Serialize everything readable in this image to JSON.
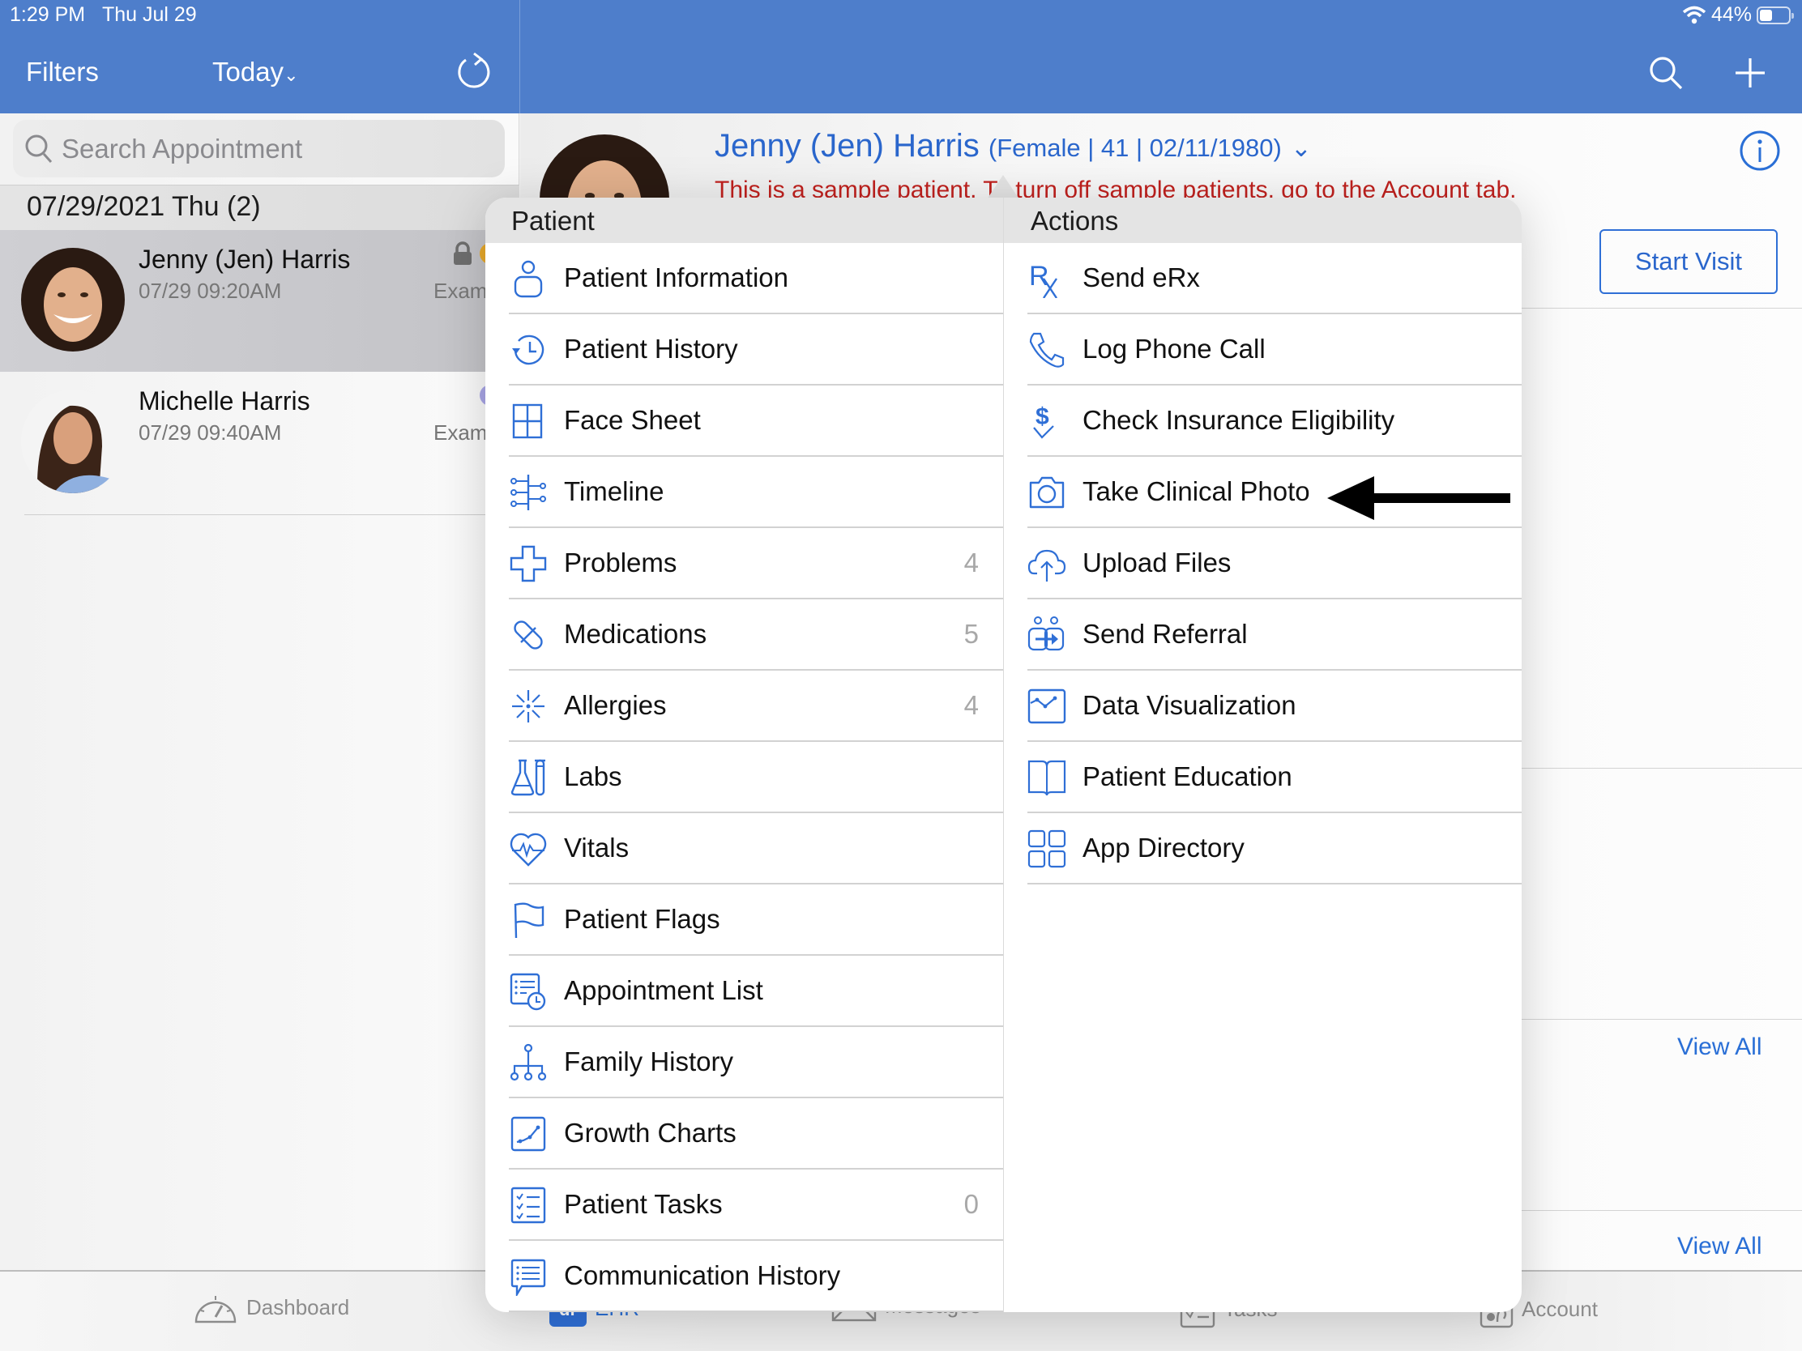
{
  "status_bar": {
    "time": "1:29 PM",
    "date": "Thu Jul 29",
    "battery": "44%",
    "battery_level": 0.44
  },
  "left_header": {
    "filters_label": "Filters",
    "date_filter_label": "Today",
    "refresh_icon": "refresh-icon"
  },
  "right_header": {
    "search_icon": "search-icon",
    "add_icon": "plus-icon"
  },
  "search": {
    "placeholder": "Search Appointment",
    "value": ""
  },
  "appointments": {
    "date_header": "07/29/2021 Thu (2)",
    "items": [
      {
        "name": "Jenny (Jen) Harris",
        "time": "07/29 09:20AM",
        "type": "Exam",
        "locked": true,
        "status_color": "#e8a92a",
        "selected": true
      },
      {
        "name": "Michelle Harris",
        "time": "07/29 09:40AM",
        "type": "Exam",
        "locked": false,
        "status_color": "#a9a6e6",
        "selected": false
      }
    ]
  },
  "patient": {
    "name": "Jenny (Jen) Harris",
    "demographics": "(Female | 41 | 02/11/1980)",
    "warning": "This is a sample patient. To turn off sample patients, go to the Account tab.",
    "start_visit_label": "Start Visit",
    "view_all_labels": [
      "View All",
      "View All"
    ]
  },
  "popover": {
    "patient_header": "Patient",
    "actions_header": "Actions",
    "patient_items": [
      {
        "label": "Patient Information",
        "icon": "person-icon",
        "count": ""
      },
      {
        "label": "Patient History",
        "icon": "history-icon",
        "count": ""
      },
      {
        "label": "Face Sheet",
        "icon": "grid-icon",
        "count": ""
      },
      {
        "label": "Timeline",
        "icon": "timeline-icon",
        "count": ""
      },
      {
        "label": "Problems",
        "icon": "medical-cross-icon",
        "count": "4"
      },
      {
        "label": "Medications",
        "icon": "pill-icon",
        "count": "5"
      },
      {
        "label": "Allergies",
        "icon": "allergy-burst-icon",
        "count": "4"
      },
      {
        "label": "Labs",
        "icon": "lab-flask-icon",
        "count": ""
      },
      {
        "label": "Vitals",
        "icon": "heart-pulse-icon",
        "count": ""
      },
      {
        "label": "Patient Flags",
        "icon": "flag-icon",
        "count": ""
      },
      {
        "label": "Appointment List",
        "icon": "appointment-list-icon",
        "count": ""
      },
      {
        "label": "Family History",
        "icon": "family-tree-icon",
        "count": ""
      },
      {
        "label": "Growth Charts",
        "icon": "growth-chart-icon",
        "count": ""
      },
      {
        "label": "Patient Tasks",
        "icon": "checklist-icon",
        "count": "0"
      },
      {
        "label": "Communication History",
        "icon": "chat-list-icon",
        "count": ""
      }
    ],
    "action_items": [
      {
        "label": "Send eRx",
        "icon": "rx-icon"
      },
      {
        "label": "Log Phone Call",
        "icon": "phone-icon"
      },
      {
        "label": "Check Insurance Eligibility",
        "icon": "dollar-check-icon"
      },
      {
        "label": "Take Clinical Photo",
        "icon": "camera-icon"
      },
      {
        "label": "Upload Files",
        "icon": "cloud-upload-icon"
      },
      {
        "label": "Send Referral",
        "icon": "referral-icon"
      },
      {
        "label": "Data Visualization",
        "icon": "line-chart-icon"
      },
      {
        "label": "Patient Education",
        "icon": "book-icon"
      },
      {
        "label": "App Directory",
        "icon": "app-grid-icon"
      }
    ],
    "highlighted_action": "Take Clinical Photo"
  },
  "tab_bar": {
    "tabs": [
      {
        "label": "Dashboard",
        "icon": "dashboard-gauge-icon",
        "active": false
      },
      {
        "label": "EHR",
        "icon": "ehr-logo-icon",
        "active": true
      },
      {
        "label": "Messages",
        "icon": "envelope-icon",
        "active": false
      },
      {
        "label": "Tasks",
        "icon": "tasks-clipboard-icon",
        "active": false
      },
      {
        "label": "Account",
        "icon": "account-icon",
        "active": false
      }
    ]
  },
  "colors": {
    "brand_blue": "#4e7ecb",
    "accent_blue": "#2a6fd6",
    "warning_red": "#c0211e",
    "icon_blue": "#2f6fd6"
  }
}
